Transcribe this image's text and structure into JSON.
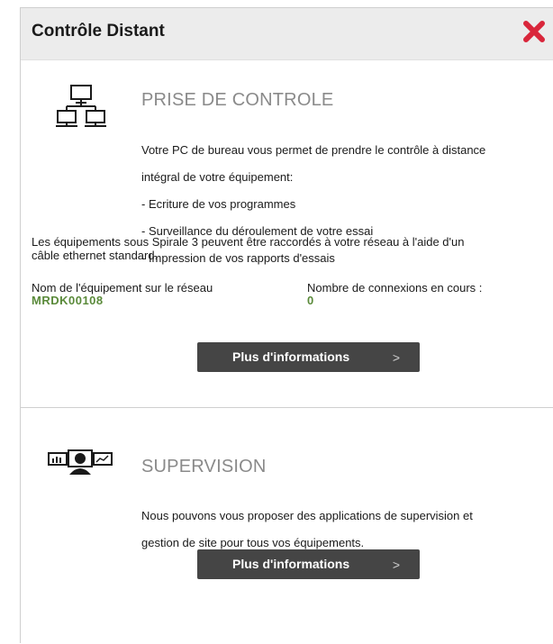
{
  "header": {
    "title": "Contrôle Distant",
    "close_icon": "close-icon",
    "close_color": "#d9263b"
  },
  "prise": {
    "icon": "network-computers-icon",
    "title": "PRISE DE CONTROLE",
    "desc_line1": "Votre PC de bureau vous permet de prendre le contrôle à distance",
    "desc_line2": "intégral de votre équipement:",
    "desc_line3": "- Ecriture de vos programmes",
    "desc_line4": "- Surveillance du déroulement de votre essai",
    "desc_line5": "- Impression de vos rapports d'essais",
    "info_line1": "Les équipements sous Spirale 3 peuvent être raccordés à votre réseau à l'aide d'un",
    "info_line2": "câble ethernet standard.",
    "device_name_label": "Nom de l'équipement sur le réseau",
    "device_name_value": "MRDK00108",
    "connections_label": "Nombre de connexions en cours :",
    "connections_value": "0",
    "button_label": "Plus d'informations",
    "button_chevron": ">"
  },
  "supervision": {
    "icon": "supervision-monitor-icon",
    "title": "SUPERVISION",
    "desc_line1": "Nous pouvons vous proposer des applications de supervision et",
    "desc_line2": "gestion de site pour tous vos équipements.",
    "button_label": "Plus d'informations",
    "button_chevron": ">"
  },
  "colors": {
    "accent_green": "#5a8a3a",
    "button_bg": "#454545",
    "header_bg": "#ececec"
  }
}
